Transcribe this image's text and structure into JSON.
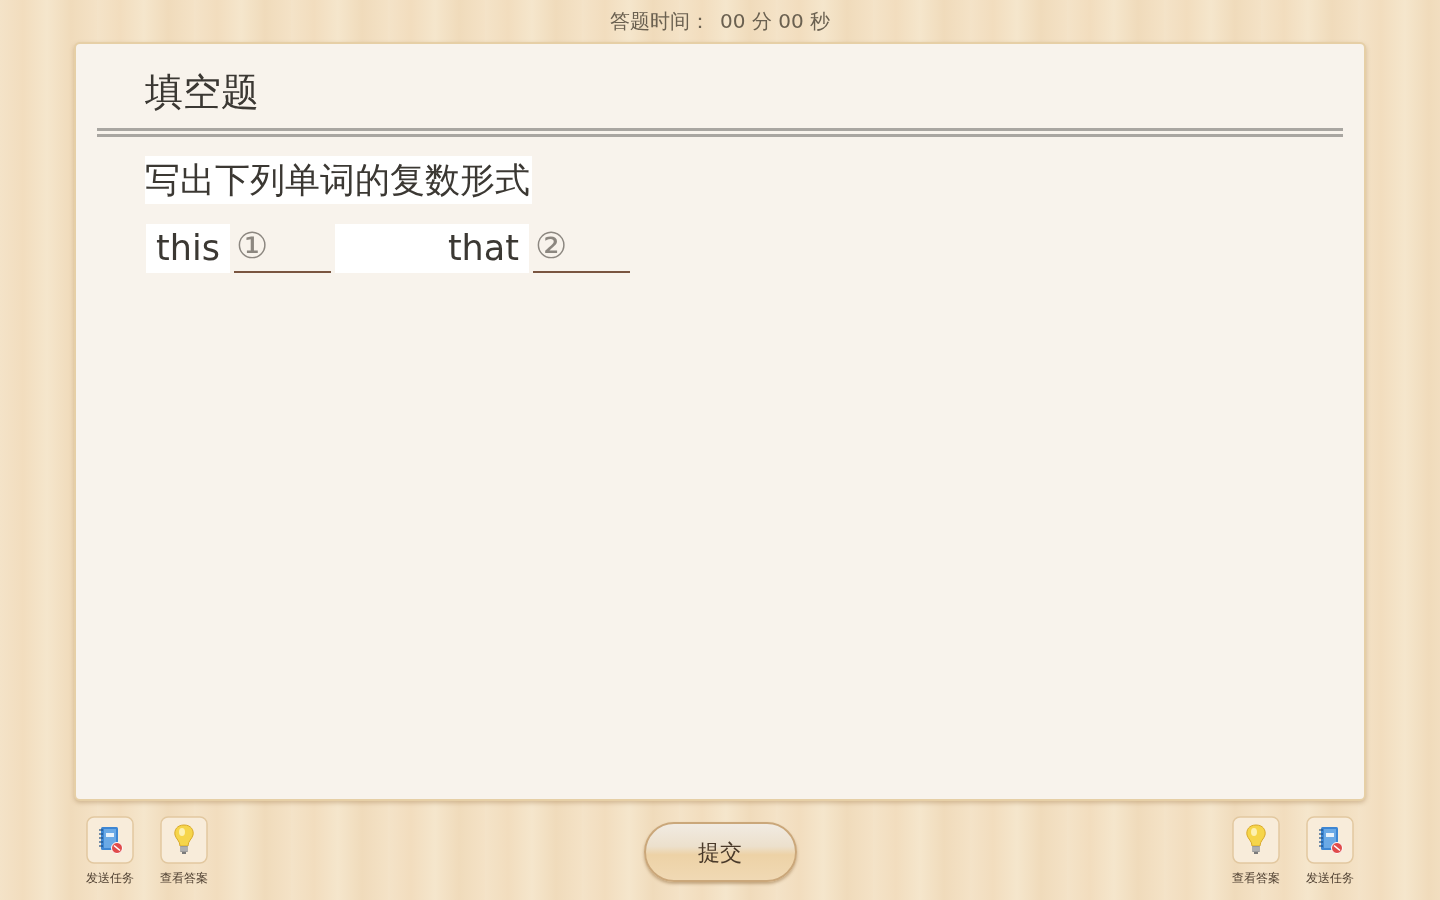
{
  "timer": {
    "label": "答题时间：",
    "value": "00 分 00 秒"
  },
  "question": {
    "type_title": "填空题",
    "instruction": "写出下列单词的复数形式",
    "items": [
      {
        "word": "this",
        "number": "①"
      },
      {
        "word": "that",
        "number": "②"
      }
    ]
  },
  "toolbar_left": [
    {
      "kind": "send",
      "label": "发送任务"
    },
    {
      "kind": "answer",
      "label": "查看答案"
    }
  ],
  "submit": {
    "label": "提交"
  },
  "toolbar_right": [
    {
      "kind": "answer",
      "label": "查看答案"
    },
    {
      "kind": "send",
      "label": "发送任务"
    }
  ]
}
